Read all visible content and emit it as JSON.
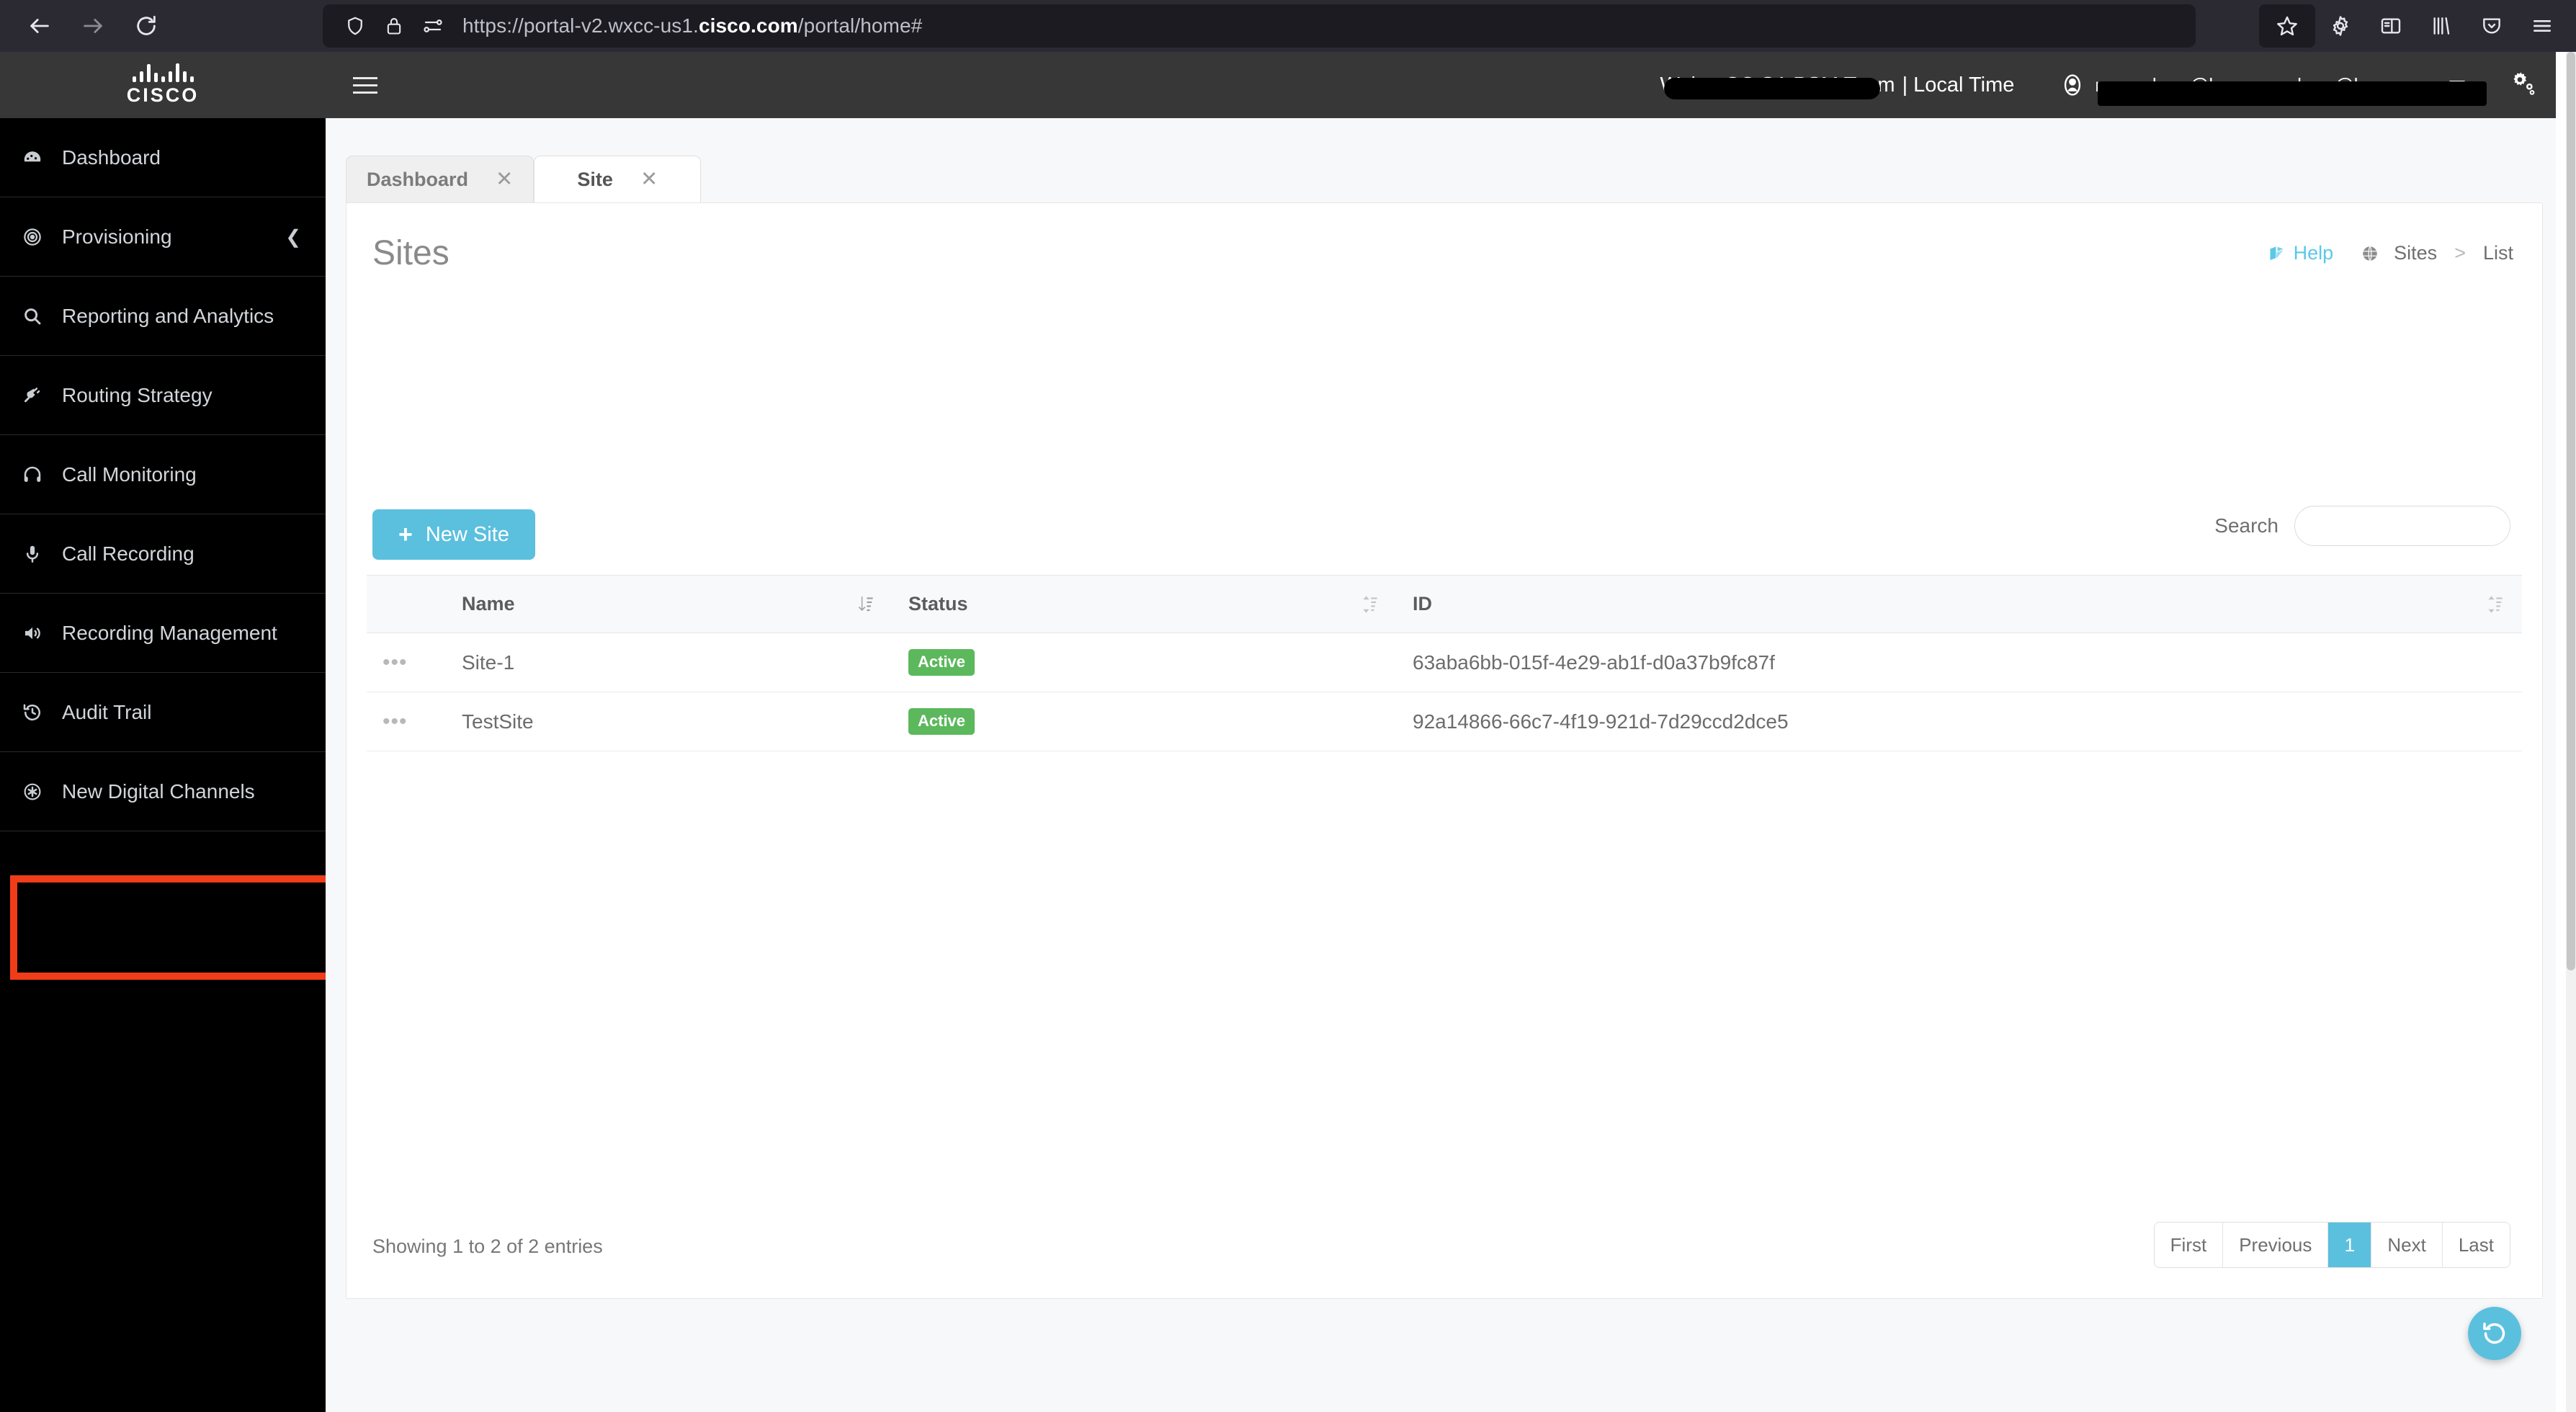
{
  "browser": {
    "back_icon": "back-arrow-icon",
    "forward_icon": "forward-arrow-icon",
    "reload_icon": "reload-icon",
    "shield_icon": "shield-icon",
    "lock_icon": "lock-icon",
    "permissions_icon": "page-settings-icon",
    "url_prefix": "https://portal-v2.wxcc-us1.",
    "url_host": "cisco.com",
    "url_suffix": "/portal/home#",
    "toolbar_icons": [
      "bookmark-star-icon",
      "extensions-gear-icon",
      "sidebar-icon",
      "library-icon",
      "pocket-icon",
      "app-menu-icon"
    ]
  },
  "header": {
    "logo_text": "CISCO",
    "hamburger_icon": "menu-icon",
    "tenant_name": "WebexCC SA PSM Team",
    "local_time_label": "| Local Time",
    "user_icon": "user-avatar-icon",
    "user_name": "name_here@here.com_here@here.com",
    "settings_icon": "admin-settings-gear-icon"
  },
  "sidebar": {
    "items": [
      {
        "label": "Dashboard",
        "icon": "dashboard-gauge-icon",
        "expandable": false
      },
      {
        "label": "Provisioning",
        "icon": "target-circles-icon",
        "expandable": true
      },
      {
        "label": "Reporting and Analytics",
        "icon": "search-magnifier-icon",
        "expandable": false
      },
      {
        "label": "Routing Strategy",
        "icon": "plug-icon",
        "expandable": false
      },
      {
        "label": "Call Monitoring",
        "icon": "headset-icon",
        "expandable": false
      },
      {
        "label": "Call Recording",
        "icon": "microphone-icon",
        "expandable": false
      },
      {
        "label": "Recording Management",
        "icon": "speaker-volume-icon",
        "expandable": false
      },
      {
        "label": "Audit Trail",
        "icon": "history-clock-icon",
        "expandable": false
      },
      {
        "label": "New Digital Channels",
        "icon": "asterisk-circle-icon",
        "expandable": false
      }
    ],
    "highlight_color": "#f03c19"
  },
  "tabs": [
    {
      "label": "Dashboard",
      "active": false,
      "close_icon": "close-icon"
    },
    {
      "label": "Site",
      "active": true,
      "close_icon": "close-icon"
    }
  ],
  "page": {
    "title": "Sites",
    "help_label": "Help",
    "help_icon": "book-help-icon",
    "breadcrumb_globe_icon": "globe-icon",
    "breadcrumb": [
      "Sites",
      "List"
    ],
    "breadcrumb_separator": ">",
    "new_site_label": "New Site",
    "new_site_plus": "+",
    "search_label": "Search",
    "search_value": "",
    "search_placeholder": "",
    "accent_color": "#5bc0de",
    "status_color": "#5cb85c"
  },
  "table": {
    "columns": [
      {
        "label": "",
        "sortable": false
      },
      {
        "label": "Name",
        "sortable": false
      },
      {
        "label": "Status",
        "sortable": true,
        "sort_icon": "sort-desc-icon"
      },
      {
        "label": "ID",
        "sortable": true,
        "sort_icon": "sort-icon"
      }
    ],
    "rows": [
      {
        "kebab_icon": "row-actions-icon",
        "name": "Site-1",
        "status": "Active",
        "id": "63aba6bb-015f-4e29-ab1f-d0a37b9fc87f"
      },
      {
        "kebab_icon": "row-actions-icon",
        "name": "TestSite",
        "status": "Active",
        "id": "92a14866-66c7-4f19-921d-7d29ccd2dce5"
      }
    ]
  },
  "footer": {
    "showing_text": "Showing 1 to 2 of 2 entries",
    "pager": [
      {
        "label": "First",
        "active": false
      },
      {
        "label": "Previous",
        "active": false
      },
      {
        "label": "1",
        "active": true
      },
      {
        "label": "Next",
        "active": false
      },
      {
        "label": "Last",
        "active": false
      }
    ]
  },
  "fab": {
    "icon": "refresh-history-icon"
  }
}
